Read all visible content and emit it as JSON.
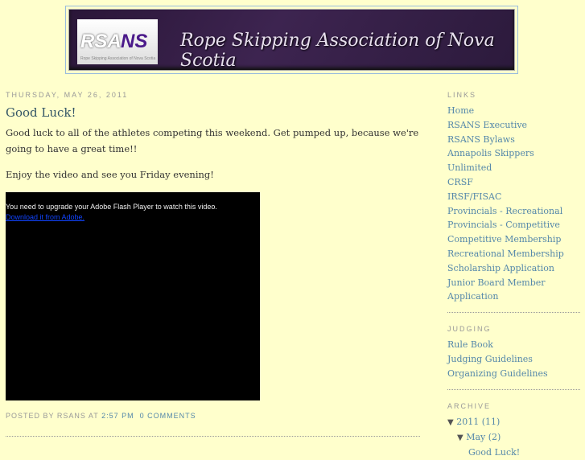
{
  "header": {
    "title": "Rope Skipping Association of Nova Scotia",
    "logo_text": "RSANS",
    "logo_sub": "Rope Skipping Association of Nova Scotia"
  },
  "post": {
    "date": "THURSDAY, MAY 26, 2011",
    "title": "Good Luck!",
    "paragraphs": [
      "Good luck to all of the athletes competing this weekend. Get pumped up, because we're going to have a great time!!",
      "Enjoy the video and see you Friday evening!"
    ],
    "video": {
      "message": "You need to upgrade your Adobe Flash Player to watch this video.",
      "link": "Download it from Adobe."
    },
    "footer": {
      "posted_by": "POSTED BY RSANS AT",
      "time": "2:57 PM",
      "comments": "0 COMMENTS"
    }
  },
  "sidebar": {
    "links": {
      "heading": "LINKS",
      "items": [
        "Home",
        "RSANS Executive",
        "RSANS Bylaws",
        "Annapolis Skippers Unlimited",
        "CRSF",
        "IRSF/FISAC",
        "Provincials - Recreational",
        "Provincials - Competitive",
        "Competitive Membership",
        "Recreational Membership",
        "Scholarship Application",
        "Junior Board Member Application"
      ]
    },
    "judging": {
      "heading": "JUDGING",
      "items": [
        "Rule Book",
        "Judging Guidelines",
        "Organizing Guidelines"
      ]
    },
    "archive": {
      "heading": "ARCHIVE",
      "year": "2011",
      "year_count": "(11)",
      "month": "May",
      "month_count": "(2)",
      "post": "Good Luck!"
    }
  }
}
